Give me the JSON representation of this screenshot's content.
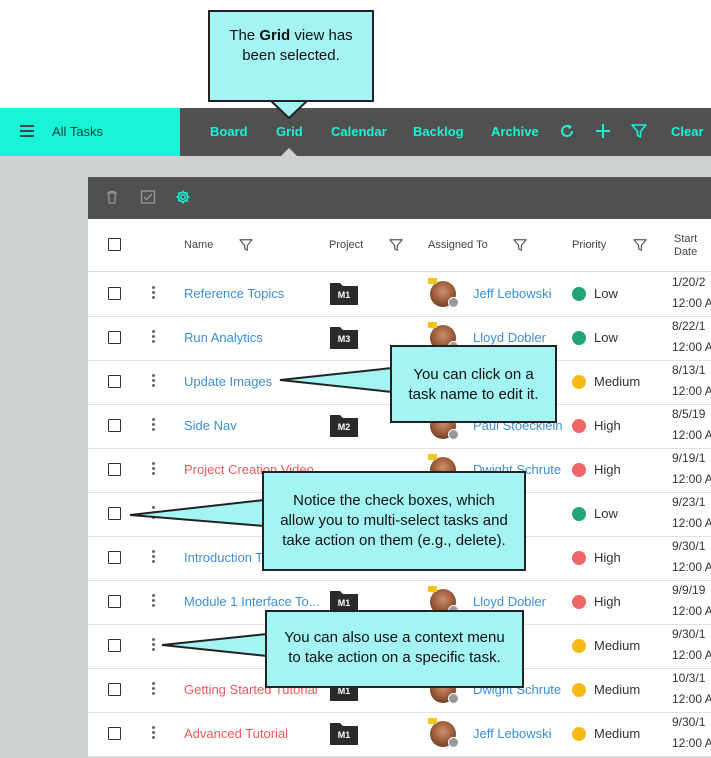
{
  "nav": {
    "title": "All Tasks",
    "tabs": [
      {
        "label": "Board"
      },
      {
        "label": "Grid"
      },
      {
        "label": "Calendar"
      },
      {
        "label": "Backlog"
      },
      {
        "label": "Archive"
      }
    ],
    "clear_label": "Clear",
    "selected_tab": "Grid",
    "icons": [
      "refresh-icon",
      "plus-icon",
      "filter-icon"
    ]
  },
  "toolbar": {
    "icons": [
      "trash-icon",
      "checklist-icon",
      "settings-icon"
    ]
  },
  "table": {
    "headers": {
      "name": "Name",
      "project": "Project",
      "assigned_to": "Assigned To",
      "priority": "Priority",
      "start_date_line1": "Start",
      "start_date_line2": "Date"
    },
    "rows": [
      {
        "name": "Reference Topics",
        "name_color": "#3b8fd6",
        "project": "M1",
        "assignee": "Jeff Lebowski",
        "priority": "Low",
        "priority_color": "#1fa57a",
        "date": "1/20/2",
        "time": "12:00 A"
      },
      {
        "name": "Run Analytics",
        "name_color": "#3b8fd6",
        "project": "M3",
        "assignee": "Lloyd Dobler",
        "priority": "Low",
        "priority_color": "#1fa57a",
        "date": "8/22/1",
        "time": "12:00 A"
      },
      {
        "name": "Update Images",
        "name_color": "#3b8fd6",
        "project": "",
        "assignee": "",
        "priority": "Medium",
        "priority_color": "#f7b915",
        "date": "8/13/1",
        "time": "12:00 A"
      },
      {
        "name": "Side Nav",
        "name_color": "#3b8fd6",
        "project": "M2",
        "assignee": "Paul Stoecklein",
        "priority": "High",
        "priority_color": "#ef6767",
        "date": "8/5/19",
        "time": "12:00 A"
      },
      {
        "name": "Project Creation Video",
        "name_color": "#ef5a5a",
        "project": "",
        "assignee": "Dwight Schrute",
        "priority": "High",
        "priority_color": "#ef6767",
        "date": "9/19/1",
        "time": "12:00 A"
      },
      {
        "name": "",
        "name_color": "#3b8fd6",
        "project": "",
        "assignee": "cklein",
        "priority": "Low",
        "priority_color": "#1fa57a",
        "date": "9/23/1",
        "time": "12:00 A"
      },
      {
        "name": "Introduction T",
        "name_color": "#3b8fd6",
        "project": "",
        "assignee": "bler",
        "priority": "High",
        "priority_color": "#ef6767",
        "date": "9/30/1",
        "time": "12:00 A"
      },
      {
        "name": "Module 1 Interface To...",
        "name_color": "#3b8fd6",
        "project": "M1",
        "assignee": "Lloyd Dobler",
        "priority": "High",
        "priority_color": "#ef6767",
        "date": "9/9/19",
        "time": "12:00 A"
      },
      {
        "name": "",
        "name_color": "#3b8fd6",
        "project": "",
        "assignee": "owski",
        "priority": "Medium",
        "priority_color": "#f7b915",
        "date": "9/30/1",
        "time": "12:00 A"
      },
      {
        "name": "Getting Started Tutorial",
        "name_color": "#ef5a5a",
        "project": "M1",
        "assignee": "Dwight Schrute",
        "priority": "Medium",
        "priority_color": "#f7b915",
        "date": "10/3/1",
        "time": "12:00 A"
      },
      {
        "name": "Advanced Tutorial",
        "name_color": "#ef5a5a",
        "project": "M1",
        "assignee": "Jeff Lebowski",
        "priority": "Medium",
        "priority_color": "#f7b915",
        "date": "9/30/1",
        "time": "12:00 A"
      }
    ]
  },
  "callouts": {
    "grid_prefix": "The ",
    "grid_bold": "Grid",
    "grid_suffix": " view has",
    "grid_line2": "been selected.",
    "task_line1": "You can click on a",
    "task_line2": "task name to edit it.",
    "check_line1": "Notice the check boxes, which",
    "check_line2": "allow you to multi-select tasks and",
    "check_line3": "take action on them (e.g., delete).",
    "menu_line1": "You can also use a context menu",
    "menu_line2": "to take action on a specific task."
  },
  "colors": {
    "accent": "#17f5d6",
    "nav_dark": "#505050",
    "link": "#3b8fd6",
    "link_red": "#ef5a5a",
    "callout": "#a3f4f2"
  }
}
